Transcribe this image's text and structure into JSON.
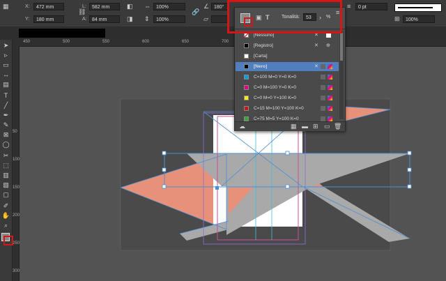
{
  "control_panel": {
    "x_label": "X:",
    "x_value": "472 mm",
    "y_label": "Y:",
    "y_value": "180 mm",
    "w_label": "L:",
    "w_value": "582 mm",
    "h_label": "A:",
    "h_value": "84 mm",
    "scale_x": "100%",
    "scale_y": "100%",
    "angle": "180°",
    "stroke_weight": "0 pt",
    "opacity": "100%"
  },
  "swatches_panel": {
    "tint_label": "Tonalità:",
    "tint_value": "53",
    "tint_unit": "%",
    "text_toggle": "T",
    "items": [
      {
        "name": "[Nessuno]",
        "color": "#ffffff"
      },
      {
        "name": "[Registro]",
        "color": "#000000"
      },
      {
        "name": "[Carta]",
        "color": "#ffffff"
      },
      {
        "name": "[Nero]",
        "color": "#000000"
      },
      {
        "name": "C=100 M=0 Y=0 K=0",
        "color": "#00a0e3"
      },
      {
        "name": "C=0 M=100 Y=0 K=0",
        "color": "#e6007e"
      },
      {
        "name": "C=0 M=0 Y=100 K=0",
        "color": "#ffed00"
      },
      {
        "name": "C=15 M=100 Y=100 K=0",
        "color": "#c8161d"
      },
      {
        "name": "C=75 M=5 Y=100 K=0",
        "color": "#3aaa35"
      }
    ],
    "selected": "[Nero]"
  },
  "rulers": {
    "h_ticks": [
      "450",
      "500",
      "550",
      "600",
      "650",
      "700"
    ],
    "v_ticks": [
      "50",
      "100",
      "150",
      "200",
      "250",
      "300"
    ]
  },
  "colors": {
    "accent": "#4a8fd6",
    "highlight": "#d4151a",
    "salmon": "#e8917a"
  }
}
